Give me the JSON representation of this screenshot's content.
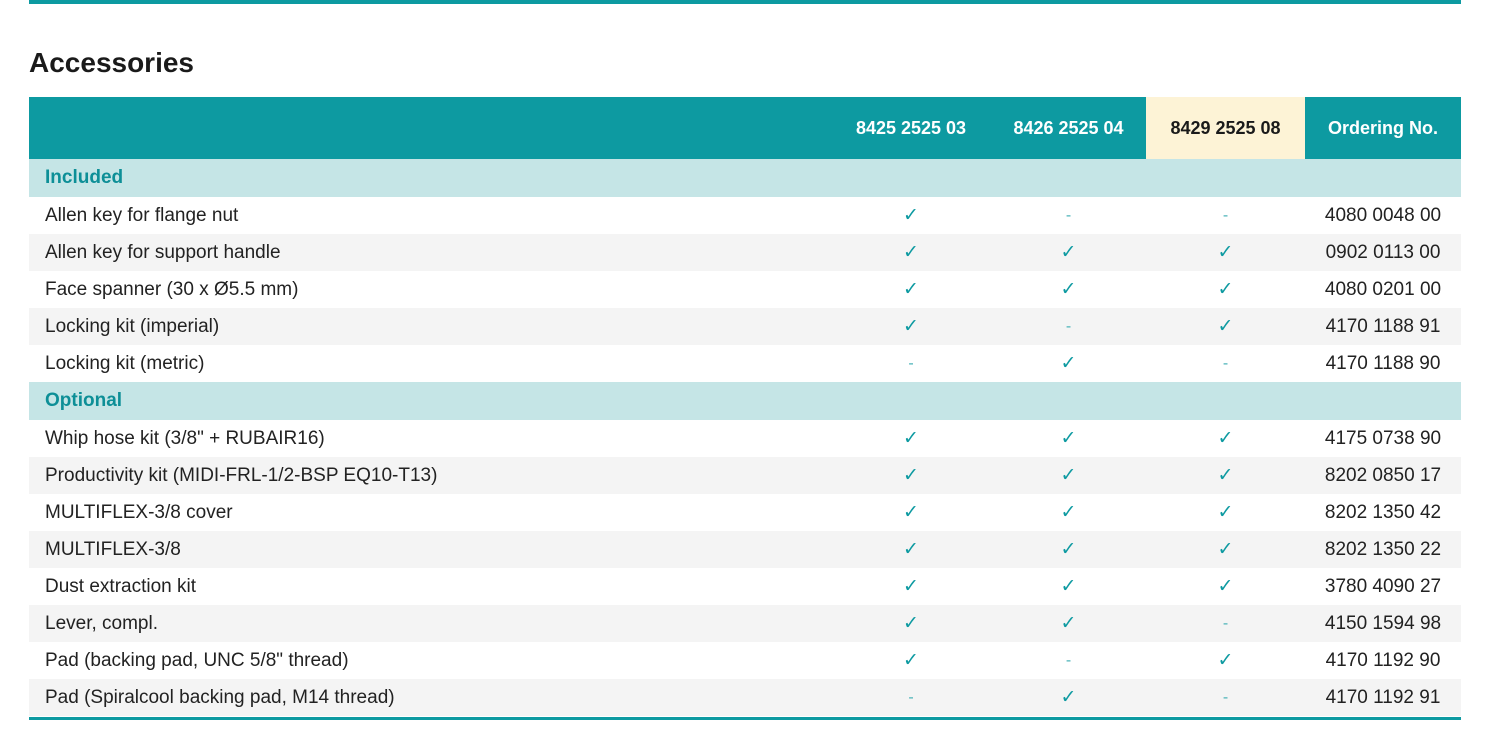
{
  "title": "Accessories",
  "columns": {
    "description": "",
    "models": [
      "8425 2525 03",
      "8426 2525 04",
      "8429 2525 08"
    ],
    "ordering": "Ordering No."
  },
  "symbols": {
    "check": "✓",
    "dash": "-"
  },
  "colors": {
    "accent": "#0d9aa1",
    "group_bg": "#c5e5e6",
    "highlight": "#fdf3d6"
  },
  "groups": [
    {
      "label": "Included",
      "rows": [
        {
          "name": "Allen key for flange nut",
          "marks": [
            "✓",
            "-",
            "-"
          ],
          "ordering": "4080 0048 00"
        },
        {
          "name": "Allen key for support handle",
          "marks": [
            "✓",
            "✓",
            "✓"
          ],
          "ordering": "0902 0113 00"
        },
        {
          "name": "Face spanner (30 x Ø5.5 mm)",
          "marks": [
            "✓",
            "✓",
            "✓"
          ],
          "ordering": "4080 0201 00"
        },
        {
          "name": "Locking kit (imperial)",
          "marks": [
            "✓",
            "-",
            "✓"
          ],
          "ordering": "4170 1188 91"
        },
        {
          "name": "Locking kit (metric)",
          "marks": [
            "-",
            "✓",
            "-"
          ],
          "ordering": "4170 1188 90"
        }
      ]
    },
    {
      "label": "Optional",
      "rows": [
        {
          "name": "Whip hose kit (3/8\" + RUBAIR16)",
          "marks": [
            "✓",
            "✓",
            "✓"
          ],
          "ordering": "4175 0738 90"
        },
        {
          "name": "Productivity kit (MIDI-FRL-1/2-BSP EQ10-T13)",
          "marks": [
            "✓",
            "✓",
            "✓"
          ],
          "ordering": "8202 0850 17"
        },
        {
          "name": "MULTIFLEX-3/8 cover",
          "marks": [
            "✓",
            "✓",
            "✓"
          ],
          "ordering": "8202 1350 42"
        },
        {
          "name": "MULTIFLEX-3/8",
          "marks": [
            "✓",
            "✓",
            "✓"
          ],
          "ordering": "8202 1350 22"
        },
        {
          "name": "Dust extraction kit",
          "marks": [
            "✓",
            "✓",
            "✓"
          ],
          "ordering": "3780 4090 27"
        },
        {
          "name": "Lever, compl.",
          "marks": [
            "✓",
            "✓",
            "-"
          ],
          "ordering": "4150 1594 98"
        },
        {
          "name": "Pad (backing pad, UNC 5/8\" thread)",
          "marks": [
            "✓",
            "-",
            "✓"
          ],
          "ordering": "4170 1192 90"
        },
        {
          "name": "Pad (Spiralcool backing pad, M14 thread)",
          "marks": [
            "-",
            "✓",
            "-"
          ],
          "ordering": "4170 1192 91"
        }
      ]
    }
  ]
}
